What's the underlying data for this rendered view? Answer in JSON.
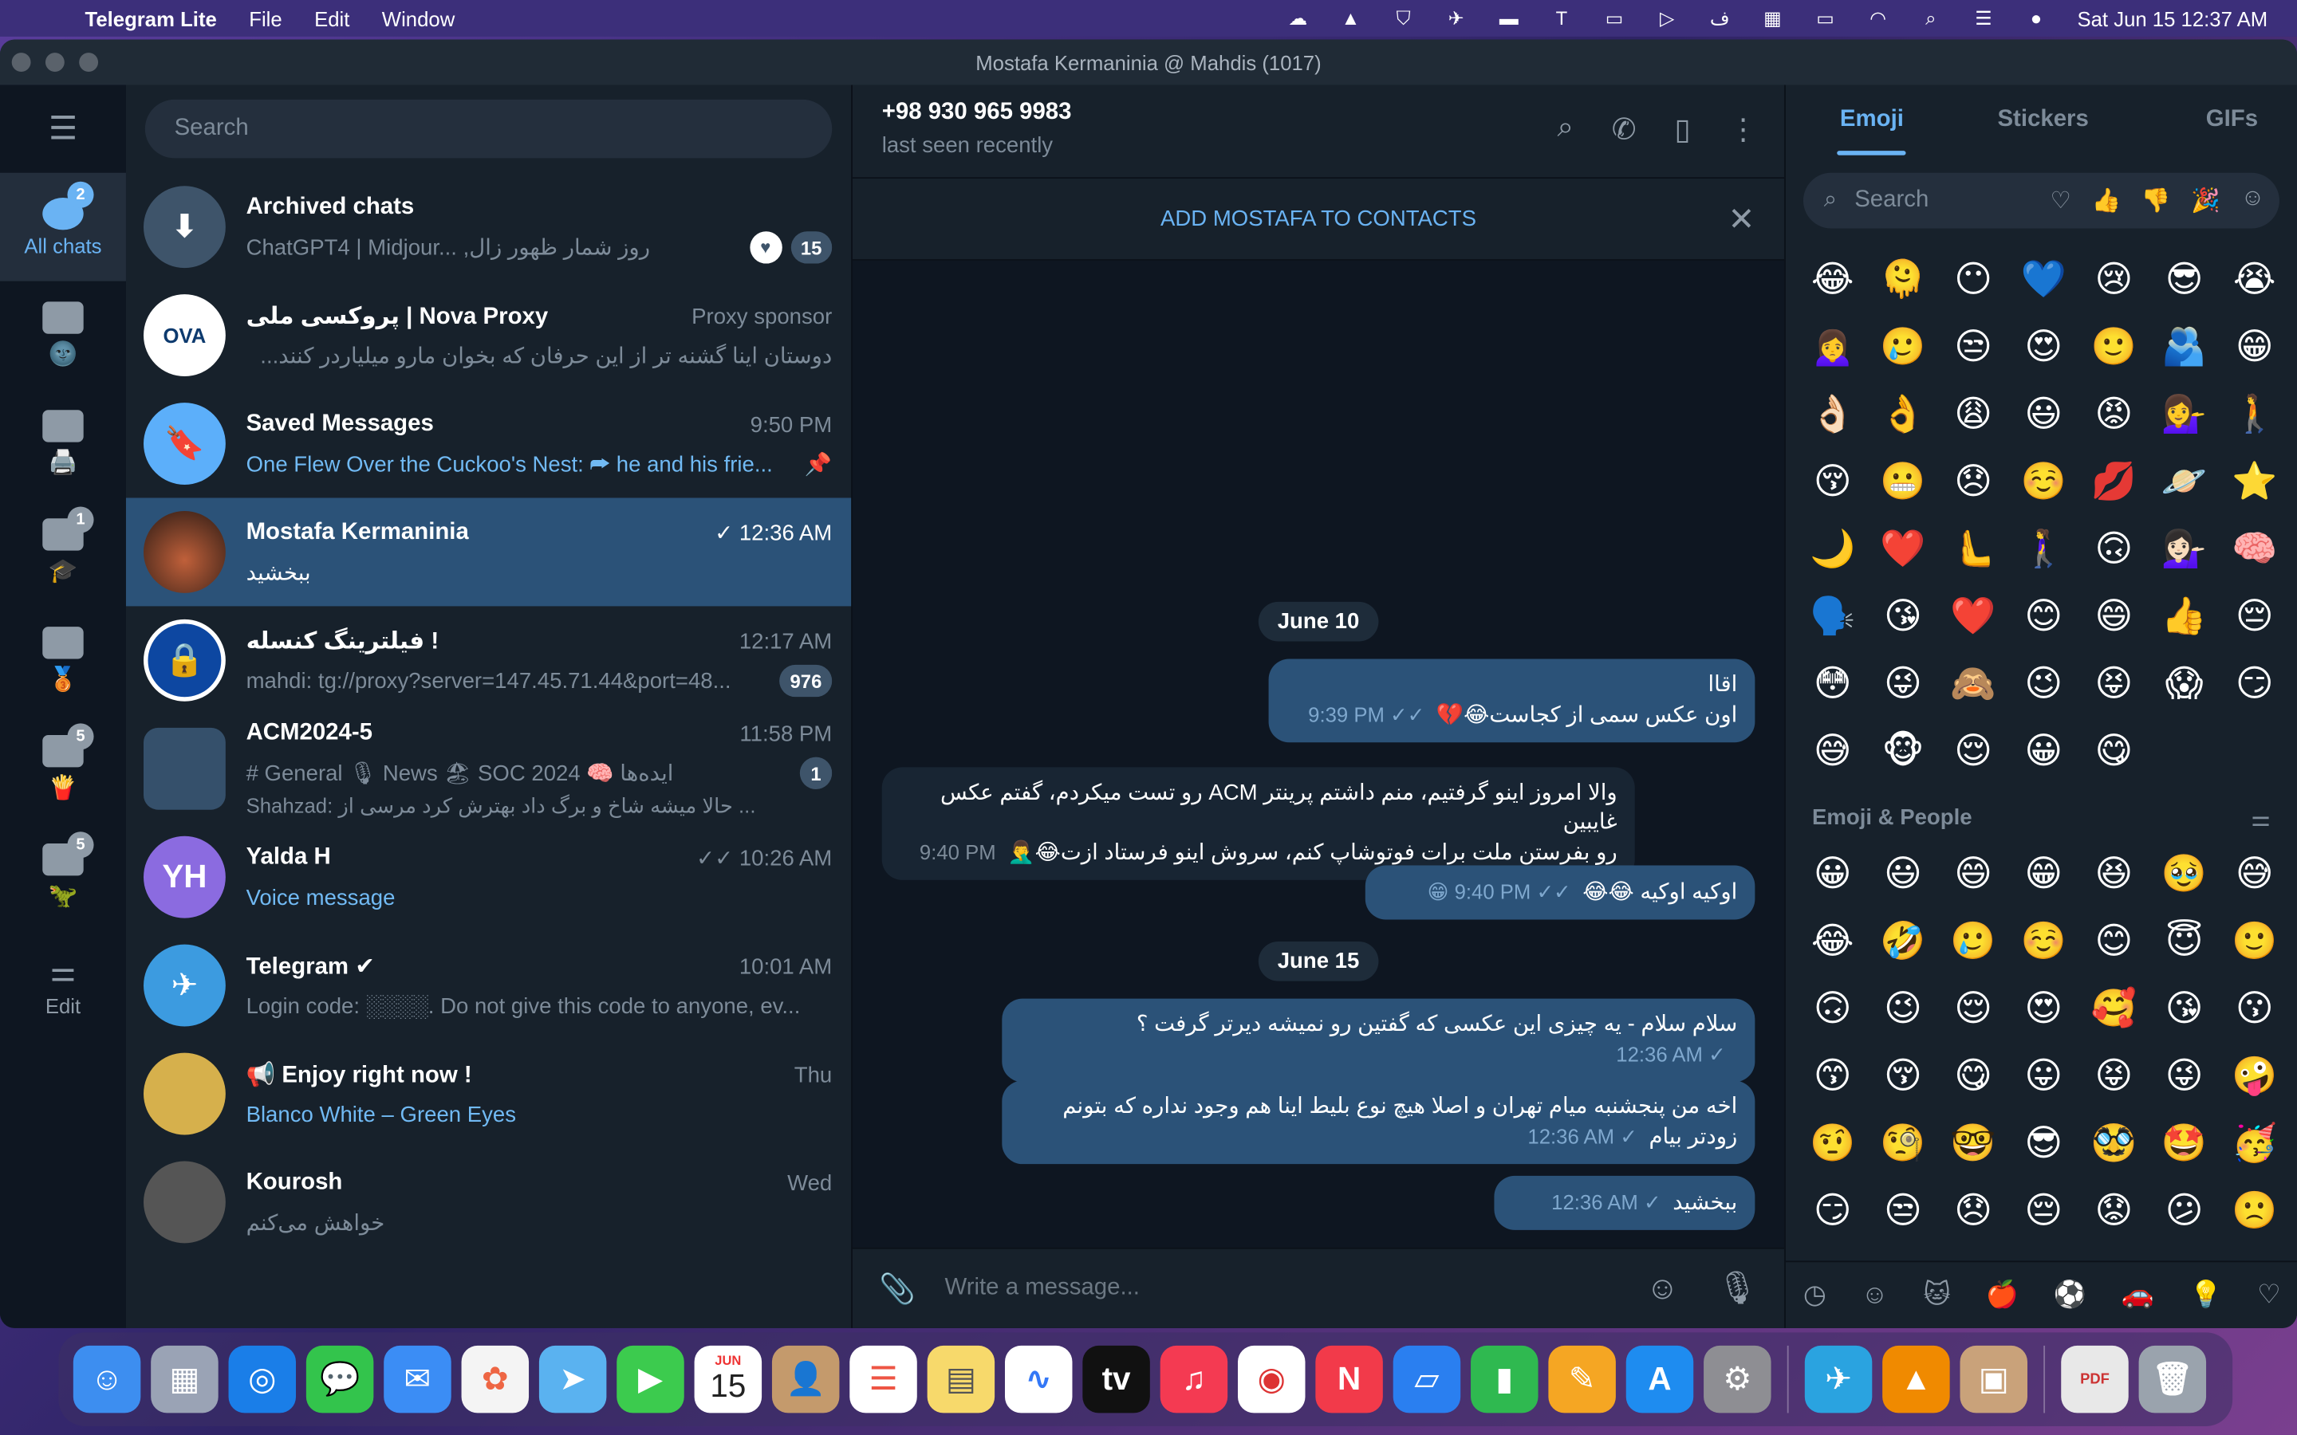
{
  "menubar": {
    "app_name": "Telegram Lite",
    "menus": [
      "File",
      "Edit",
      "Window"
    ],
    "clock": "Sat Jun 15  12:37 AM"
  },
  "window": {
    "title": "Mostafa Kermaninia @ Mahdis (1017)"
  },
  "leftnav": {
    "all_chats_label": "All chats",
    "all_chats_badge": "2",
    "folder_badges": [
      "",
      "1",
      "",
      "5",
      "5"
    ],
    "folder_emojis": [
      "🌚",
      "🖨️",
      "🎓",
      "🥉",
      "🍟",
      "🦖"
    ],
    "edit_label": "Edit"
  },
  "chatlist": {
    "search_placeholder": "Search",
    "chats": [
      {
        "name": "Archived chats",
        "time": "",
        "preview": "ChatGPT4 | Midjour... ,روز شمار ظهور زال",
        "badge": "15",
        "avatar_text": "⬇",
        "avatar_color": "#3e546a"
      },
      {
        "name": "پروکسی ملی | Nova Proxy",
        "time": "Proxy sponsor",
        "preview": "دوستان اینا گشنه تر از این حرفان که بخوان مارو میلیاردر کنند...",
        "badge": "",
        "avatar_text": "OVA",
        "avatar_color": "#ffffff"
      },
      {
        "name": "Saved Messages",
        "time": "9:50 PM",
        "preview": "One Flew Over the Cuckoo's Nest: ⮫ he and his frie...",
        "badge": "",
        "avatar_text": "🔖",
        "avatar_color": "#5caffa"
      },
      {
        "name": "Mostafa Kermaninia",
        "time": "✓ 12:36 AM",
        "preview": "ببخشید",
        "badge": "",
        "avatar_text": "",
        "avatar_color": "#6b4a3a"
      },
      {
        "name": "فیلترینگ کنسله !",
        "time": "12:17 AM",
        "preview": "mahdi: tg://proxy?server=147.45.71.44&port=48...",
        "badge": "976",
        "avatar_text": "🔒",
        "avatar_color": "#0d47a1"
      },
      {
        "name": "ACM2024-5",
        "time": "11:58 PM",
        "preview": "# General   🎙 News   🏖 SOC 2024   🧠 ایده‌ها",
        "preview2": "Shahzad: حالا میشه شاخ و برگ داد بهترش کرد مرسی از ...",
        "badge": "1",
        "avatar_text": "",
        "avatar_color": "#35506b"
      },
      {
        "name": "Yalda H",
        "time": "✓✓ 10:26 AM",
        "preview": "Voice message",
        "badge": "",
        "avatar_text": "YH",
        "avatar_color": "#8b6be0"
      },
      {
        "name": "Telegram ✔",
        "time": "10:01 AM",
        "preview": "Login code: ░░░░. Do not give this code to anyone, ev...",
        "badge": "",
        "avatar_text": "✈",
        "avatar_color": "#3c9be0"
      },
      {
        "name": "📢 Enjoy right now !",
        "time": "Thu",
        "preview": "Blanco White – Green Eyes",
        "badge": "",
        "avatar_text": "",
        "avatar_color": "#d6b04c"
      },
      {
        "name": "Kourosh",
        "time": "Wed",
        "preview": "خواهش می‌کنم",
        "badge": "",
        "avatar_text": "",
        "avatar_color": "#555"
      }
    ]
  },
  "chat": {
    "peer_name": "+98 930 965 9983",
    "peer_status": "last seen recently",
    "add_contact": "ADD MOSTAFA TO CONTACTS",
    "date1": "June 10",
    "date2": "June 15",
    "messages": [
      {
        "text_line1": "اقاا",
        "text_line2": "اون عکس سمی از کجاست😂💔",
        "time": "9:39 PM ✓✓"
      },
      {
        "text_line1": "والا امروز اینو گرفتیم، منم داشتم پرینتر ACM رو تست میکردم، گفتم عکس غایبین",
        "text_line2": "رو بفرستن ملت برات فوتوشاپ کنم، سروش اینو فرستاد ازت😂🤦‍♂️",
        "time": "9:40 PM"
      },
      {
        "text_line1": "اوکیه اوکیه 😂😂",
        "text_line2": "",
        "time": "😁 9:40 PM ✓✓"
      },
      {
        "text_line1": "سلام سلام - یه چیزی این عکسی که گفتین رو نمیشه دیرتر گرفت ؟",
        "text_line2": "",
        "time": "12:36 AM ✓"
      },
      {
        "text_line1": "اخه من پنجشنبه میام تهران و اصلا هیچ نوع بلیط اینا هم وجود نداره که بتونم",
        "text_line2": "زودتر بیام",
        "time": "12:36 AM ✓"
      },
      {
        "text_line1": "ببخشید",
        "text_line2": "",
        "time": "12:36 AM ✓"
      }
    ],
    "composer_placeholder": "Write a message..."
  },
  "emoji": {
    "tabs": [
      "Emoji",
      "Stickers",
      "GIFs"
    ],
    "search_placeholder": "Search",
    "recent": [
      "😂",
      "🫠",
      "😶",
      "💙",
      "😢",
      "😎",
      "😭",
      "🙍‍♀️",
      "🥲",
      "😒",
      "😍",
      "🙂",
      "🫂",
      "😁",
      "👌🏻",
      "👌",
      "😩",
      "😃",
      "😡",
      "💁‍♀️",
      "🚶",
      "😚",
      "😬",
      "😞",
      "☺️",
      "💋",
      "🪐",
      "⭐",
      "🌙",
      "❤️",
      "🫷",
      "🚶‍♀️",
      "🙃",
      "💁🏻‍♀️",
      "🧠",
      "🗣️",
      "😘",
      "❤️",
      "😊",
      "😄",
      "👍",
      "😔",
      "😳",
      "😜",
      "🙈",
      "😉",
      "😝",
      "😱",
      "😏",
      "😅",
      "🐵",
      "😌",
      "😀",
      "😋"
    ],
    "section_title": "Emoji & People",
    "people": [
      "😀",
      "😃",
      "😄",
      "😁",
      "😆",
      "🥹",
      "😅",
      "😂",
      "🤣",
      "🥲",
      "☺️",
      "😊",
      "😇",
      "🙂",
      "🙃",
      "😉",
      "😌",
      "😍",
      "🥰",
      "😘",
      "😗",
      "😙",
      "😚",
      "😋",
      "😛",
      "😝",
      "😜",
      "🤪",
      "🤨",
      "🧐",
      "🤓",
      "😎",
      "🥸",
      "🤩",
      "🥳",
      "😏",
      "😒",
      "😞",
      "😔",
      "😟",
      "😕",
      "🙁"
    ]
  },
  "dock": {
    "calendar_month": "JUN",
    "calendar_day": "15"
  }
}
